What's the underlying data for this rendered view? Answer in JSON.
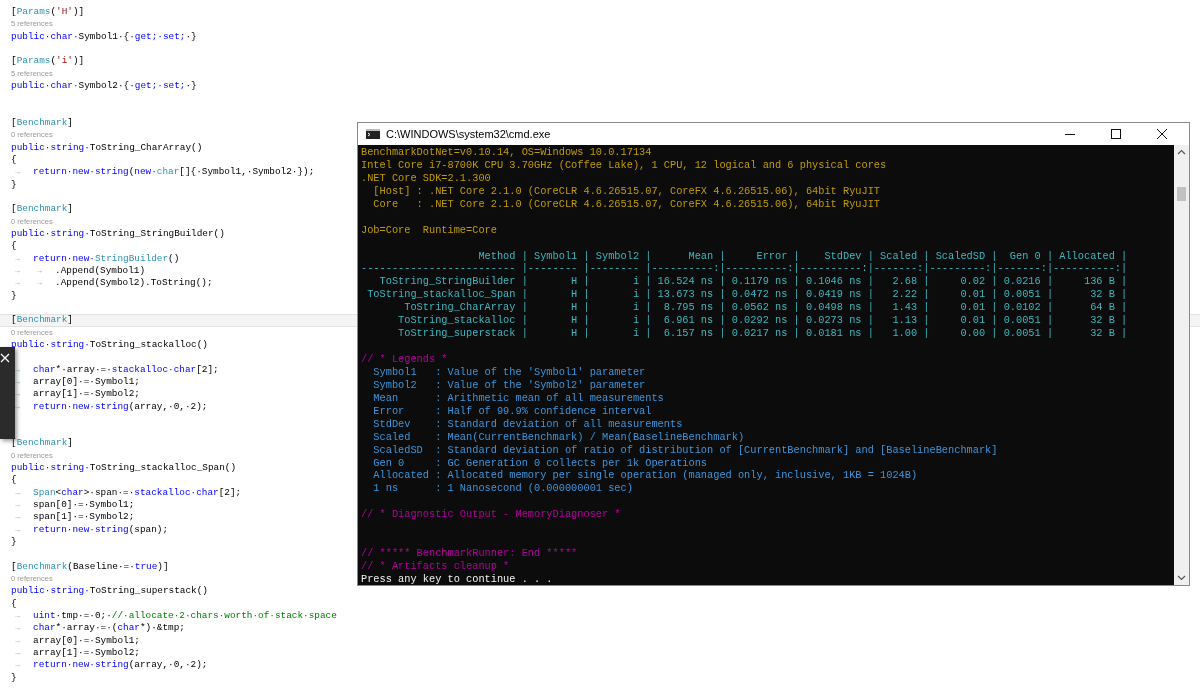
{
  "editor": {
    "lines": [
      {
        "kind": "code",
        "current": false,
        "segments": [
          {
            "kind": "plain",
            "text": "["
          },
          {
            "kind": "type",
            "text": "Params"
          },
          {
            "kind": "plain",
            "text": "("
          },
          {
            "kind": "str",
            "text": "'H'"
          },
          {
            "kind": "plain",
            "text": ")]"
          }
        ]
      },
      {
        "kind": "lens",
        "current": false,
        "text": "5 references"
      },
      {
        "kind": "code",
        "current": false,
        "segments": [
          {
            "kind": "kw",
            "text": "public·char·"
          },
          {
            "kind": "plain",
            "text": "Symbol1·{·"
          },
          {
            "kind": "kw",
            "text": "get;·set;"
          },
          {
            "kind": "plain",
            "text": "·}"
          }
        ]
      },
      {
        "kind": "blank",
        "current": false
      },
      {
        "kind": "code",
        "current": false,
        "segments": [
          {
            "kind": "plain",
            "text": "["
          },
          {
            "kind": "type",
            "text": "Params"
          },
          {
            "kind": "plain",
            "text": "("
          },
          {
            "kind": "str",
            "text": "'i'"
          },
          {
            "kind": "plain",
            "text": ")]"
          }
        ]
      },
      {
        "kind": "lens",
        "current": false,
        "text": "5 references"
      },
      {
        "kind": "code",
        "current": false,
        "segments": [
          {
            "kind": "kw",
            "text": "public·char·"
          },
          {
            "kind": "plain",
            "text": "Symbol2·{·"
          },
          {
            "kind": "kw",
            "text": "get;·set;"
          },
          {
            "kind": "plain",
            "text": "·}"
          }
        ]
      },
      {
        "kind": "blank",
        "current": false
      },
      {
        "kind": "blank",
        "current": false
      },
      {
        "kind": "code",
        "current": false,
        "segments": [
          {
            "kind": "plain",
            "text": "["
          },
          {
            "kind": "type",
            "text": "Benchmark"
          },
          {
            "kind": "plain",
            "text": "]"
          }
        ]
      },
      {
        "kind": "lens",
        "current": false,
        "text": "0 references"
      },
      {
        "kind": "code",
        "current": false,
        "segments": [
          {
            "kind": "kw",
            "text": "public·string·"
          },
          {
            "kind": "plain",
            "text": "ToString_CharArray()"
          }
        ]
      },
      {
        "kind": "code",
        "current": false,
        "segments": [
          {
            "kind": "plain",
            "text": "{"
          }
        ]
      },
      {
        "kind": "code",
        "current": false,
        "segments": [
          {
            "kind": "tab",
            "text": "→"
          },
          {
            "kind": "kw",
            "text": "return·new·string"
          },
          {
            "kind": "plain",
            "text": "("
          },
          {
            "kind": "kw",
            "text": "new·"
          },
          {
            "kind": "type",
            "text": "char"
          },
          {
            "kind": "plain",
            "text": "[]{·Symbol1,·Symbol2·});"
          }
        ]
      },
      {
        "kind": "code",
        "current": false,
        "segments": [
          {
            "kind": "plain",
            "text": "}"
          }
        ]
      },
      {
        "kind": "blank",
        "current": false
      },
      {
        "kind": "code",
        "current": false,
        "segments": [
          {
            "kind": "plain",
            "text": "["
          },
          {
            "kind": "type",
            "text": "Benchmark"
          },
          {
            "kind": "plain",
            "text": "]"
          }
        ]
      },
      {
        "kind": "lens",
        "current": false,
        "text": "0 references"
      },
      {
        "kind": "code",
        "current": false,
        "segments": [
          {
            "kind": "kw",
            "text": "public·string·"
          },
          {
            "kind": "plain",
            "text": "ToString_StringBuilder()"
          }
        ]
      },
      {
        "kind": "code",
        "current": false,
        "segments": [
          {
            "kind": "plain",
            "text": "{"
          }
        ]
      },
      {
        "kind": "code",
        "current": false,
        "segments": [
          {
            "kind": "tab",
            "text": "→"
          },
          {
            "kind": "kw",
            "text": "return·new·"
          },
          {
            "kind": "type",
            "text": "StringBuilder"
          },
          {
            "kind": "plain",
            "text": "()"
          }
        ]
      },
      {
        "kind": "code",
        "current": false,
        "segments": [
          {
            "kind": "tab",
            "text": "→"
          },
          {
            "kind": "tab",
            "text": "→"
          },
          {
            "kind": "plain",
            "text": ".Append(Symbol1)"
          }
        ]
      },
      {
        "kind": "code",
        "current": false,
        "segments": [
          {
            "kind": "tab",
            "text": "→"
          },
          {
            "kind": "tab",
            "text": "→"
          },
          {
            "kind": "plain",
            "text": ".Append(Symbol2).ToString();"
          }
        ]
      },
      {
        "kind": "code",
        "current": false,
        "segments": [
          {
            "kind": "plain",
            "text": "}"
          }
        ]
      },
      {
        "kind": "blank",
        "current": false
      },
      {
        "kind": "code",
        "current": true,
        "segments": [
          {
            "kind": "plain",
            "text": "["
          },
          {
            "kind": "type",
            "text": "Benchmark"
          },
          {
            "kind": "plain",
            "text": "]"
          }
        ]
      },
      {
        "kind": "lens",
        "current": false,
        "text": "0 references"
      },
      {
        "kind": "code",
        "current": false,
        "segments": [
          {
            "kind": "kw",
            "text": "public·string·"
          },
          {
            "kind": "plain",
            "text": "ToString_stackalloc()"
          }
        ]
      },
      {
        "kind": "blank",
        "current": false
      },
      {
        "kind": "code",
        "current": false,
        "segments": [
          {
            "kind": "tab",
            "text": "→"
          },
          {
            "kind": "kw",
            "text": "char"
          },
          {
            "kind": "plain",
            "text": "*·array·=·"
          },
          {
            "kind": "kw",
            "text": "stackalloc·char"
          },
          {
            "kind": "plain",
            "text": "[2];"
          }
        ]
      },
      {
        "kind": "code",
        "current": false,
        "segments": [
          {
            "kind": "tab",
            "text": "→"
          },
          {
            "kind": "plain",
            "text": "array[0]·=·Symbol1;"
          }
        ]
      },
      {
        "kind": "code",
        "current": false,
        "segments": [
          {
            "kind": "tab",
            "text": "→"
          },
          {
            "kind": "plain",
            "text": "array[1]·=·Symbol2;"
          }
        ]
      },
      {
        "kind": "code",
        "current": false,
        "segments": [
          {
            "kind": "tab",
            "text": "→"
          },
          {
            "kind": "kw",
            "text": "return·new·string"
          },
          {
            "kind": "plain",
            "text": "(array,·0,·2);"
          }
        ]
      },
      {
        "kind": "blank",
        "current": false
      },
      {
        "kind": "blank",
        "current": false
      },
      {
        "kind": "code",
        "current": false,
        "segments": [
          {
            "kind": "plain",
            "text": "["
          },
          {
            "kind": "type",
            "text": "Benchmark"
          },
          {
            "kind": "plain",
            "text": "]"
          }
        ]
      },
      {
        "kind": "lens",
        "current": false,
        "text": "0 references"
      },
      {
        "kind": "code",
        "current": false,
        "segments": [
          {
            "kind": "kw",
            "text": "public·string·"
          },
          {
            "kind": "plain",
            "text": "ToString_stackalloc_Span()"
          }
        ]
      },
      {
        "kind": "code",
        "current": false,
        "segments": [
          {
            "kind": "plain",
            "text": "{"
          }
        ]
      },
      {
        "kind": "code",
        "current": false,
        "segments": [
          {
            "kind": "tab",
            "text": "→"
          },
          {
            "kind": "type",
            "text": "Span"
          },
          {
            "kind": "plain",
            "text": "<"
          },
          {
            "kind": "kw",
            "text": "char"
          },
          {
            "kind": "plain",
            "text": ">·span·=·"
          },
          {
            "kind": "kw",
            "text": "stackalloc·char"
          },
          {
            "kind": "plain",
            "text": "[2];"
          }
        ]
      },
      {
        "kind": "code",
        "current": false,
        "segments": [
          {
            "kind": "tab",
            "text": "→"
          },
          {
            "kind": "plain",
            "text": "span[0]·=·Symbol1;"
          }
        ]
      },
      {
        "kind": "code",
        "current": false,
        "segments": [
          {
            "kind": "tab",
            "text": "→"
          },
          {
            "kind": "plain",
            "text": "span[1]·=·Symbol2;"
          }
        ]
      },
      {
        "kind": "code",
        "current": false,
        "segments": [
          {
            "kind": "tab",
            "text": "→"
          },
          {
            "kind": "kw",
            "text": "return·new·string"
          },
          {
            "kind": "plain",
            "text": "(span);"
          }
        ]
      },
      {
        "kind": "code",
        "current": false,
        "segments": [
          {
            "kind": "plain",
            "text": "}"
          }
        ]
      },
      {
        "kind": "blank",
        "current": false
      },
      {
        "kind": "code",
        "current": false,
        "segments": [
          {
            "kind": "plain",
            "text": "["
          },
          {
            "kind": "type",
            "text": "Benchmark"
          },
          {
            "kind": "plain",
            "text": "(Baseline·=·"
          },
          {
            "kind": "kw",
            "text": "true"
          },
          {
            "kind": "plain",
            "text": ")]"
          }
        ]
      },
      {
        "kind": "lens",
        "current": false,
        "text": "0 references"
      },
      {
        "kind": "code",
        "current": false,
        "segments": [
          {
            "kind": "kw",
            "text": "public·string·"
          },
          {
            "kind": "plain",
            "text": "ToString_superstack()"
          }
        ]
      },
      {
        "kind": "code",
        "current": false,
        "segments": [
          {
            "kind": "plain",
            "text": "{"
          }
        ]
      },
      {
        "kind": "code",
        "current": false,
        "segments": [
          {
            "kind": "tab",
            "text": "→"
          },
          {
            "kind": "kw",
            "text": "uint"
          },
          {
            "kind": "plain",
            "text": "·tmp·=·0;·"
          },
          {
            "kind": "cmt",
            "text": "//·allocate·2·chars·worth·of·stack·space"
          }
        ]
      },
      {
        "kind": "code",
        "current": false,
        "segments": [
          {
            "kind": "tab",
            "text": "→"
          },
          {
            "kind": "kw",
            "text": "char"
          },
          {
            "kind": "plain",
            "text": "*·array·=·("
          },
          {
            "kind": "kw",
            "text": "char"
          },
          {
            "kind": "plain",
            "text": "*)·&tmp;"
          }
        ]
      },
      {
        "kind": "code",
        "current": false,
        "segments": [
          {
            "kind": "tab",
            "text": "→"
          },
          {
            "kind": "plain",
            "text": "array[0]·=·Symbol1;"
          }
        ]
      },
      {
        "kind": "code",
        "current": false,
        "segments": [
          {
            "kind": "tab",
            "text": "→"
          },
          {
            "kind": "plain",
            "text": "array[1]·=·Symbol2;"
          }
        ]
      },
      {
        "kind": "code",
        "current": false,
        "segments": [
          {
            "kind": "tab",
            "text": "→"
          },
          {
            "kind": "kw",
            "text": "return·new·string"
          },
          {
            "kind": "plain",
            "text": "(array,·0,·2);"
          }
        ]
      },
      {
        "kind": "code",
        "current": false,
        "segments": [
          {
            "kind": "plain",
            "text": "}"
          }
        ]
      }
    ]
  },
  "console": {
    "title": "C:\\WINDOWS\\system32\\cmd.exe",
    "lines": [
      {
        "kind": "info",
        "text": "BenchmarkDotNet=v0.10.14, OS=Windows 10.0.17134"
      },
      {
        "kind": "info",
        "text": "Intel Core i7-8700K CPU 3.70GHz (Coffee Lake), 1 CPU, 12 logical and 6 physical cores"
      },
      {
        "kind": "info",
        "text": ".NET Core SDK=2.1.300"
      },
      {
        "kind": "info",
        "text": "  [Host] : .NET Core 2.1.0 (CoreCLR 4.6.26515.07, CoreFX 4.6.26515.06), 64bit RyuJIT"
      },
      {
        "kind": "info",
        "text": "  Core   : .NET Core 2.1.0 (CoreCLR 4.6.26515.07, CoreFX 4.6.26515.06), 64bit RyuJIT"
      },
      {
        "kind": "blank"
      },
      {
        "kind": "info",
        "text": "Job=Core  Runtime=Core"
      },
      {
        "kind": "blank"
      },
      {
        "kind": "table",
        "text": "                   Method | Symbol1 | Symbol2 |      Mean |     Error |    StdDev | Scaled | ScaledSD |  Gen 0 | Allocated |"
      },
      {
        "kind": "table",
        "text": "------------------------- |-------- |-------- |----------:|----------:|----------:|-------:|---------:|-------:|----------:|"
      },
      {
        "kind": "table",
        "text": "   ToString_StringBuilder |       H |       i | 16.524 ns | 0.1179 ns | 0.1046 ns |   2.68 |     0.02 | 0.0216 |     136 B |"
      },
      {
        "kind": "table",
        "text": " ToString_stackalloc_Span |       H |       i | 13.673 ns | 0.0472 ns | 0.0419 ns |   2.22 |     0.01 | 0.0051 |      32 B |"
      },
      {
        "kind": "table",
        "text": "       ToString_CharArray |       H |       i |  8.795 ns | 0.0562 ns | 0.0498 ns |   1.43 |     0.01 | 0.0102 |      64 B |"
      },
      {
        "kind": "table",
        "text": "      ToString_stackalloc |       H |       i |  6.961 ns | 0.0292 ns | 0.0273 ns |   1.13 |     0.01 | 0.0051 |      32 B |"
      },
      {
        "kind": "table",
        "text": "      ToString_superstack |       H |       i |  6.157 ns | 0.0217 ns | 0.0181 ns |   1.00 |     0.00 | 0.0051 |      32 B |"
      },
      {
        "kind": "blank"
      },
      {
        "kind": "comment",
        "text": "// * Legends *"
      },
      {
        "kind": "legend",
        "text": "  Symbol1   : Value of the 'Symbol1' parameter"
      },
      {
        "kind": "legend",
        "text": "  Symbol2   : Value of the 'Symbol2' parameter"
      },
      {
        "kind": "legend",
        "text": "  Mean      : Arithmetic mean of all measurements"
      },
      {
        "kind": "legend",
        "text": "  Error     : Half of 99.9% confidence interval"
      },
      {
        "kind": "legend",
        "text": "  StdDev    : Standard deviation of all measurements"
      },
      {
        "kind": "legend",
        "text": "  Scaled    : Mean(CurrentBenchmark) / Mean(BaselineBenchmark)"
      },
      {
        "kind": "legend",
        "text": "  ScaledSD  : Standard deviation of ratio of distribution of [CurrentBenchmark] and [BaselineBenchmark]"
      },
      {
        "kind": "legend",
        "text": "  Gen 0     : GC Generation 0 collects per 1k Operations"
      },
      {
        "kind": "legend",
        "text": "  Allocated : Allocated memory per single operation (managed only, inclusive, 1KB = 1024B)"
      },
      {
        "kind": "legend",
        "text": "  1 ns      : 1 Nanosecond (0.000000001 sec)"
      },
      {
        "kind": "blank"
      },
      {
        "kind": "comment",
        "text": "// * Diagnostic Output - MemoryDiagnoser *"
      },
      {
        "kind": "blank"
      },
      {
        "kind": "blank"
      },
      {
        "kind": "comment",
        "text": "// ***** BenchmarkRunner: End *****"
      },
      {
        "kind": "comment",
        "text": "// * Artifacts cleanup *"
      },
      {
        "kind": "prompt",
        "text": "Press any key to continue . . ."
      }
    ]
  }
}
